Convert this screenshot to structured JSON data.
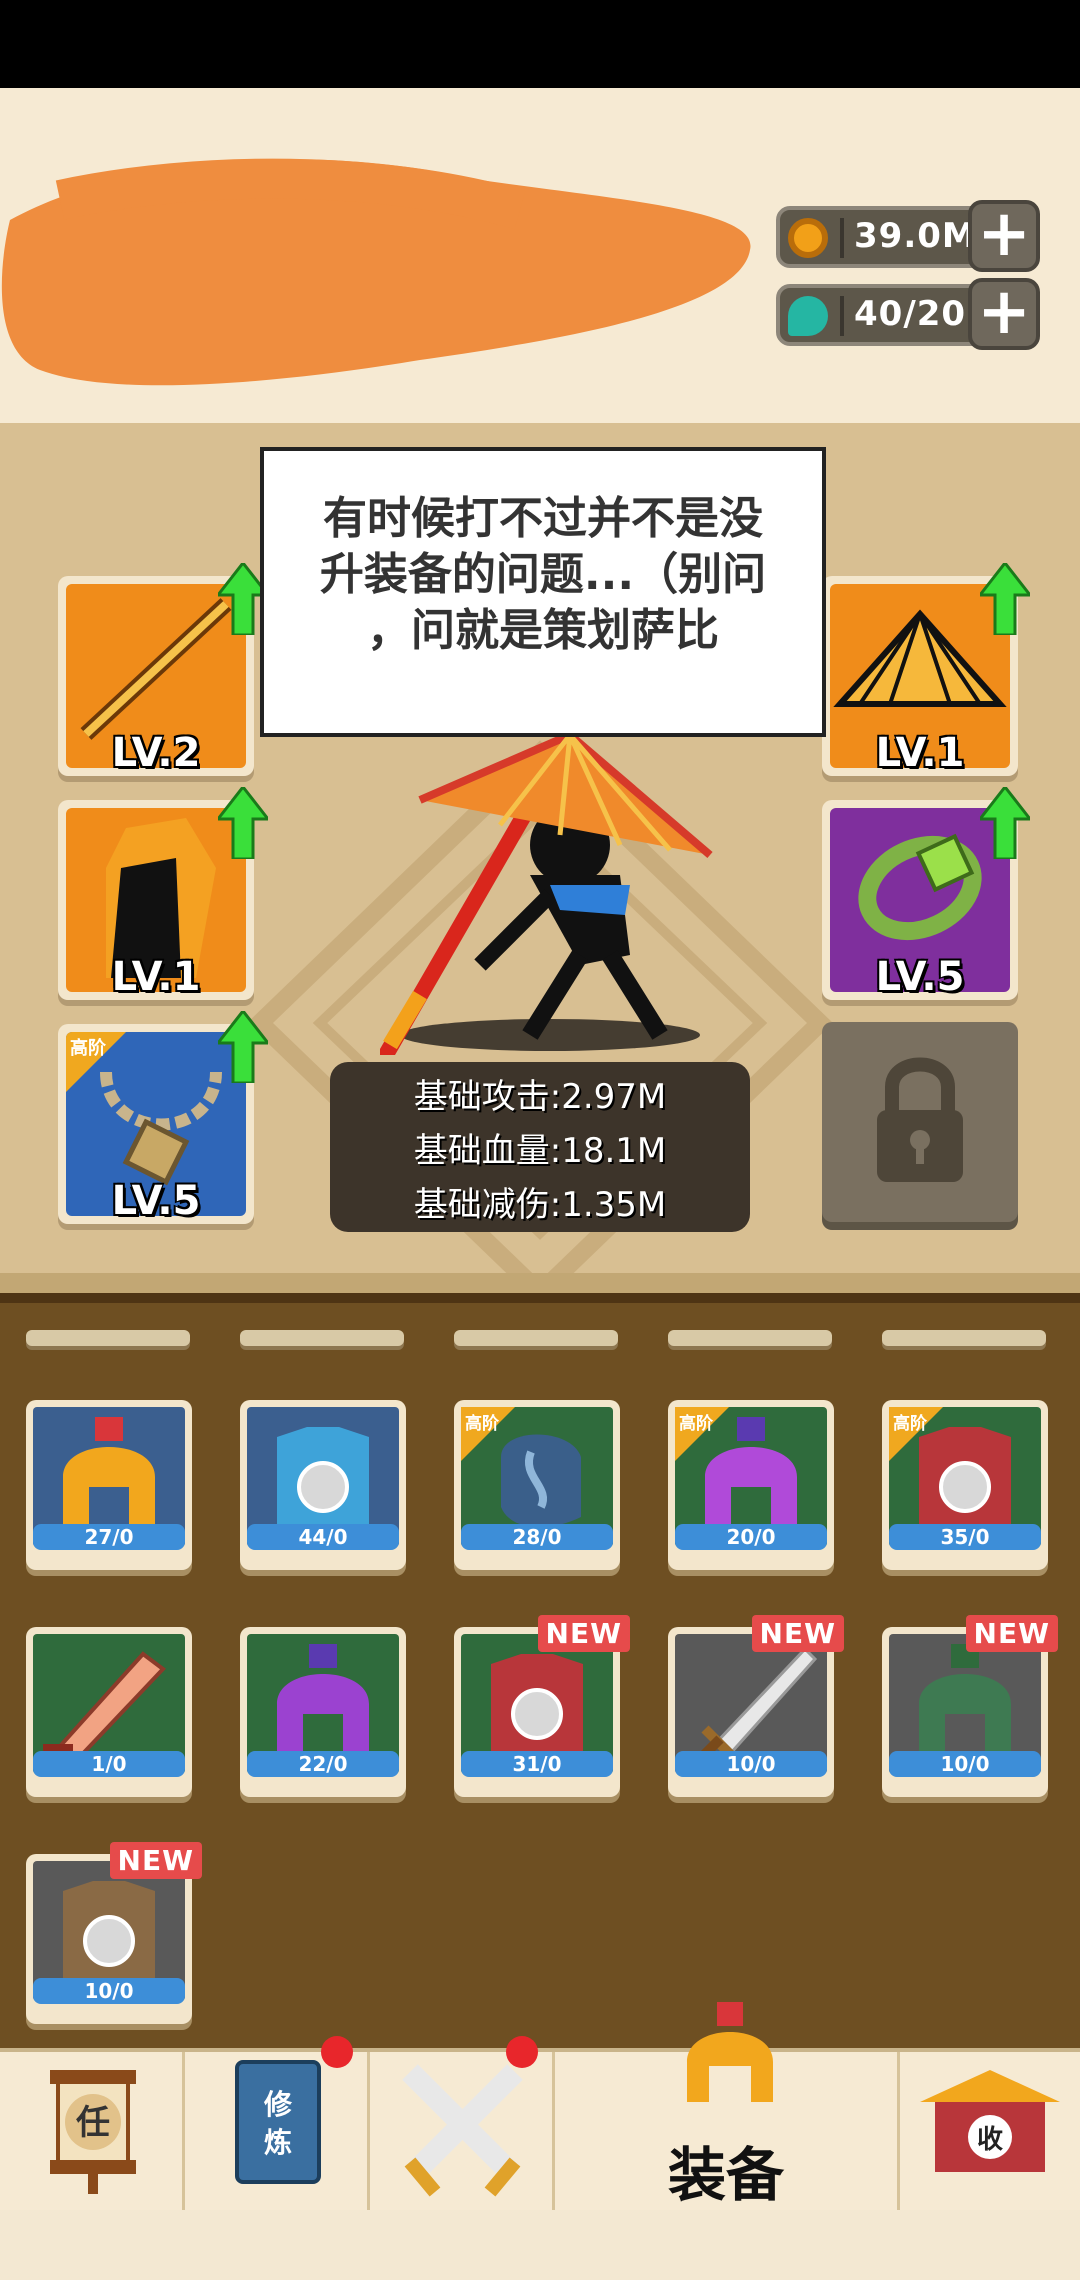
{
  "resources": {
    "coins": {
      "value": "39.0M",
      "icon": "coin-icon"
    },
    "gems": {
      "value": "40/20",
      "icon": "energy-drop-icon"
    }
  },
  "tip_text": "有时候打不过并不是没升装备的问题...（别问，问就是策划萨比",
  "tip_lines": [
    "有时候打不过并不是没",
    "升装备的问题...（别问",
    "，问就是策划萨比"
  ],
  "equipment_slots": {
    "left": [
      {
        "name": "staff",
        "level": "LV.2",
        "upgradable": true
      },
      {
        "name": "armor",
        "level": "LV.1",
        "upgradable": true
      },
      {
        "name": "necklace",
        "level": "LV.5",
        "upgradable": true,
        "badge": "高阶"
      }
    ],
    "right": [
      {
        "name": "hat",
        "level": "LV.1",
        "upgradable": true
      },
      {
        "name": "bracelet",
        "level": "LV.5",
        "upgradable": true
      },
      {
        "name": "locked",
        "level": "",
        "upgradable": false
      }
    ]
  },
  "stats": {
    "attack": "基础攻击:2.97M",
    "hp": "基础血量:18.1M",
    "reduction": "基础减伤:1.35M"
  },
  "inventory": [
    {
      "item": "helmet-gold",
      "count": "27/0",
      "badge": "",
      "new": false,
      "bg": "#3b5f8f"
    },
    {
      "item": "armor-blue",
      "count": "44/0",
      "badge": "",
      "new": false,
      "bg": "#3b5f8f"
    },
    {
      "item": "glove-blue",
      "count": "28/0",
      "badge": "高阶",
      "new": false,
      "bg": "#2f6b3c"
    },
    {
      "item": "helmet-purple",
      "count": "20/0",
      "badge": "高阶",
      "new": false,
      "bg": "#2f6b3c"
    },
    {
      "item": "armor-red",
      "count": "35/0",
      "badge": "高阶",
      "new": false,
      "bg": "#2f6b3c"
    },
    {
      "item": "sword-broken",
      "count": "1/0",
      "badge": "",
      "new": false,
      "bg": "#2f6b3c"
    },
    {
      "item": "helmet-purple-2",
      "count": "22/0",
      "badge": "",
      "new": false,
      "bg": "#2f6b3c"
    },
    {
      "item": "armor-red-2",
      "count": "31/0",
      "badge": "",
      "new": true,
      "bg": "#2f6b3c"
    },
    {
      "item": "sword-silver",
      "count": "10/0",
      "badge": "",
      "new": true,
      "bg": "#595959"
    },
    {
      "item": "helmet-green",
      "count": "10/0",
      "badge": "",
      "new": true,
      "bg": "#595959"
    },
    {
      "item": "armor-brown",
      "count": "10/0",
      "badge": "",
      "new": true,
      "bg": "#595959"
    }
  ],
  "new_label": "NEW",
  "nav": {
    "task": {
      "glyph": "任"
    },
    "cultivate": {
      "glyph": "修炼",
      "dot": true
    },
    "battle": {
      "dot": true
    },
    "equip": {
      "label": "装备"
    },
    "collect": {
      "glyph": "收"
    }
  },
  "colors": {
    "upgrade_arrow": "#3adf3a",
    "count_bar": "#3d8ed8",
    "new_badge": "#e64b4b"
  }
}
